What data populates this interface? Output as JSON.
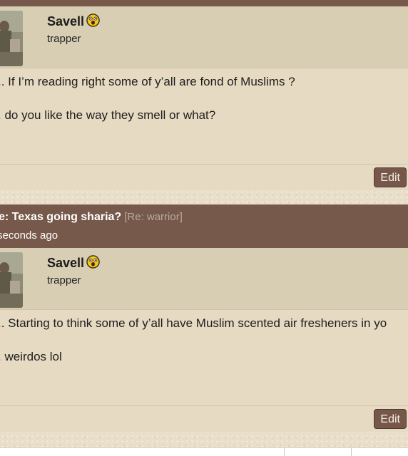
{
  "posts": [
    {
      "subject": "",
      "reply_ref": "",
      "time": "",
      "author": {
        "name": "Savell",
        "title": "trapper",
        "status_icon": "shocked-smiley-icon"
      },
      "body": [
        ".. If I’m reading right some of y’all are fond of Muslims ?",
        ". do you like the way they smell or what?"
      ],
      "edit_label": "Edit"
    },
    {
      "subject": "e: Texas going sharia?",
      "reply_ref": "[Re: warrior]",
      "time": "seconds ago",
      "author": {
        "name": "Savell",
        "title": "trapper",
        "status_icon": "shocked-smiley-icon"
      },
      "body": [
        ".. Starting to think some of y’all have Muslim scented air fresheners in yo",
        ". weirdos lol"
      ],
      "edit_label": "Edit"
    }
  ],
  "colors": {
    "header_brown": "#76594a",
    "user_bar": "#d8ceb4",
    "post_body": "#e6dac2",
    "edit_button": "#77574a"
  }
}
